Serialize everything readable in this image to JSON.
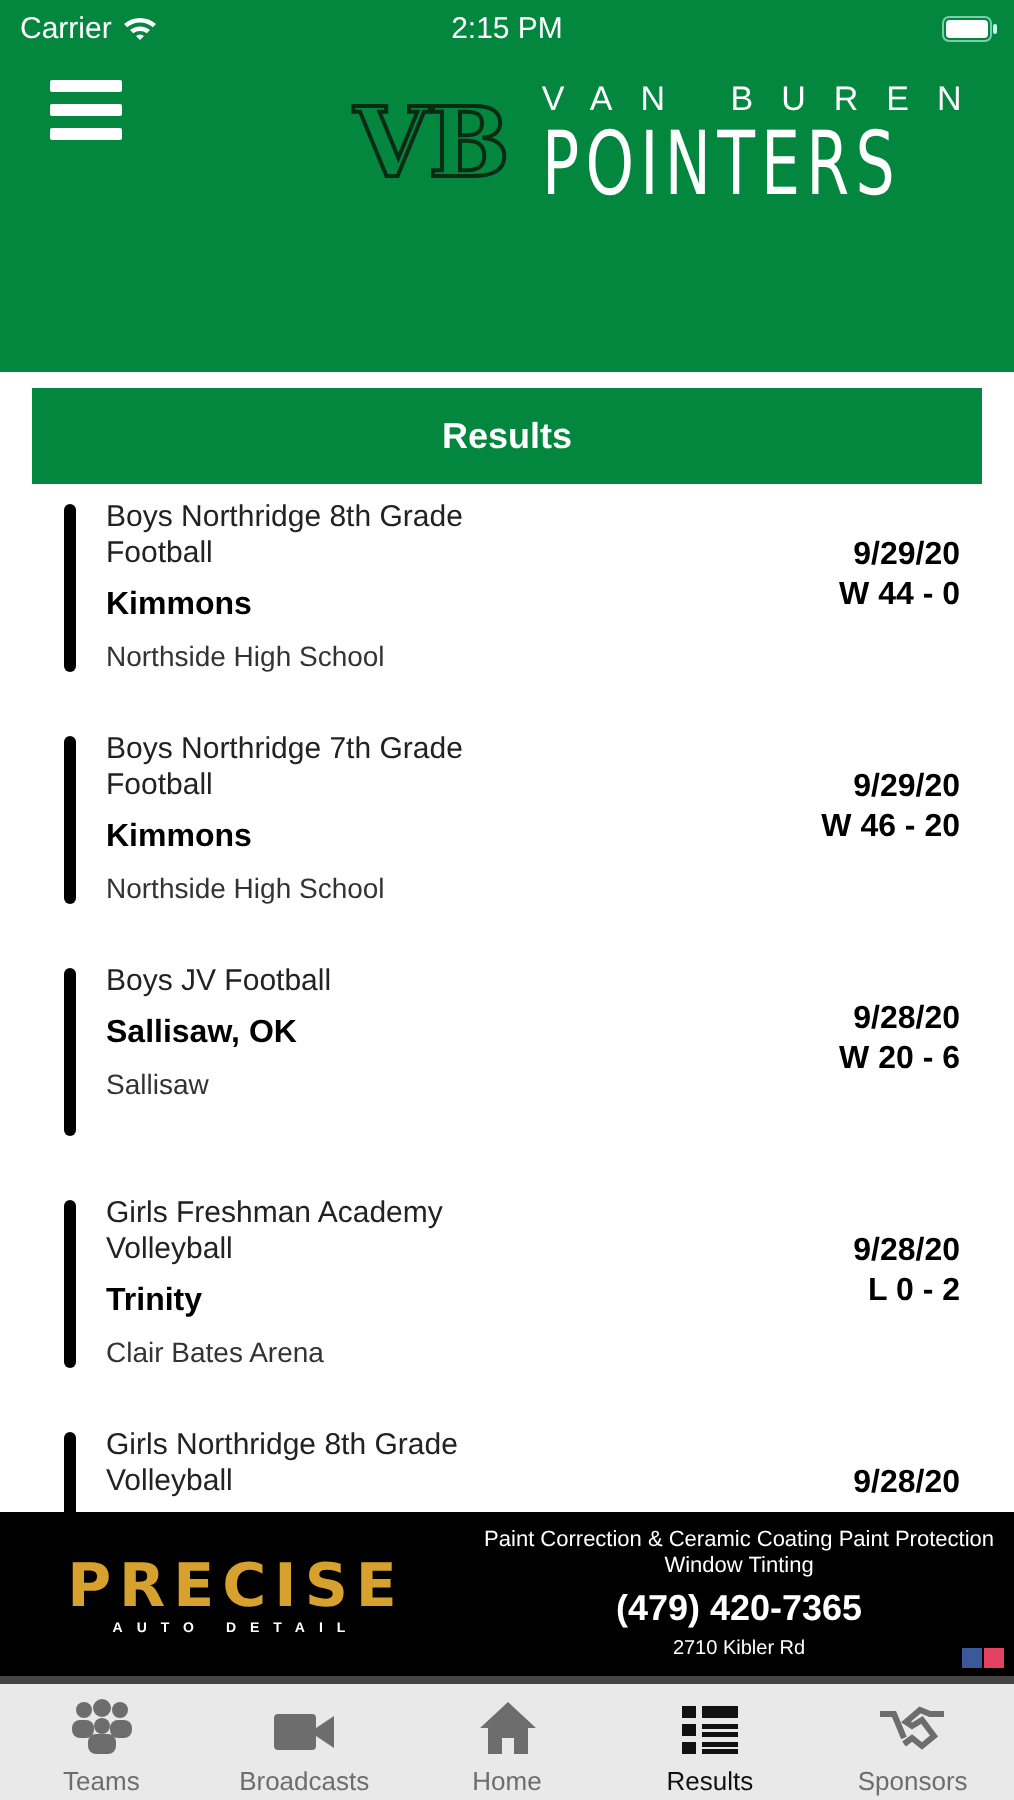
{
  "status_bar": {
    "carrier": "Carrier",
    "time": "2:15 PM"
  },
  "header": {
    "monogram": "VB",
    "school": "VAN BUREN",
    "team": "POINTERS"
  },
  "section_title": "Results",
  "results": [
    {
      "event": "Boys Northridge 8th Grade Football",
      "opponent": "Kimmons",
      "venue": "Northside High School",
      "date": "9/29/20",
      "score": "W 44 - 0"
    },
    {
      "event": "Boys Northridge 7th Grade Football",
      "opponent": "Kimmons",
      "venue": "Northside High School",
      "date": "9/29/20",
      "score": "W 46 - 20"
    },
    {
      "event": "Boys JV Football",
      "opponent": "Sallisaw, OK",
      "venue": "Sallisaw",
      "date": "9/28/20",
      "score": "W 20 - 6"
    },
    {
      "event": "Girls Freshman Academy Volleyball",
      "opponent": "Trinity",
      "venue": "Clair Bates Arena",
      "date": "9/28/20",
      "score": "L 0 - 2"
    },
    {
      "event": "Girls Northridge 8th Grade Volleyball",
      "date": "9/28/20"
    }
  ],
  "ad": {
    "brand": "PRECISE",
    "brand_sub": "AUTO DETAIL",
    "services": "Paint Correction & Ceramic Coating Paint Protection",
    "services_2": "Window Tinting",
    "phone": "(479) 420-7365",
    "address": "2710 Kibler Rd"
  },
  "tabs": [
    {
      "label": "Teams",
      "selected": false
    },
    {
      "label": "Broadcasts",
      "selected": false
    },
    {
      "label": "Home",
      "selected": false
    },
    {
      "label": "Results",
      "selected": true
    },
    {
      "label": "Sponsors",
      "selected": false
    }
  ]
}
